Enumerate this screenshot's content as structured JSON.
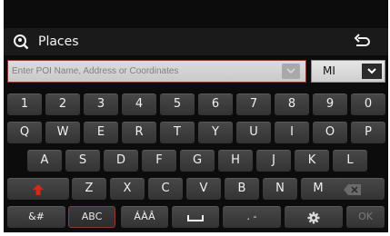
{
  "header": {
    "title": "Places",
    "icon": "poi-search-icon",
    "back_icon": "back-arrow-icon"
  },
  "search": {
    "placeholder": "Enter POI Name, Address or Coordinates",
    "value": ""
  },
  "units": {
    "selected": "MI"
  },
  "keyboard": {
    "row1": [
      "1",
      "2",
      "3",
      "4",
      "5",
      "6",
      "7",
      "8",
      "9",
      "0"
    ],
    "row2": [
      "Q",
      "W",
      "E",
      "R",
      "T",
      "Y",
      "U",
      "I",
      "O",
      "P"
    ],
    "row3": [
      "A",
      "S",
      "D",
      "F",
      "G",
      "H",
      "J",
      "K",
      "L"
    ],
    "row4": [
      "Z",
      "X",
      "C",
      "V",
      "B",
      "N",
      "M"
    ],
    "shift_icon": "shift-arrow-icon",
    "delete_icon": "backspace-icon",
    "symbols_label": "&#",
    "abc_label": "ABC",
    "accents_label": "ÁÀÂ",
    "space_icon": "space-icon",
    "dotdash_label": ". -",
    "settings_icon": "gear-icon",
    "ok_label": "OK"
  },
  "colors": {
    "accent": "#8c3a2f",
    "shift": "#d42a1e",
    "background": "#0c0c0c",
    "key": "#3b3b3b"
  }
}
